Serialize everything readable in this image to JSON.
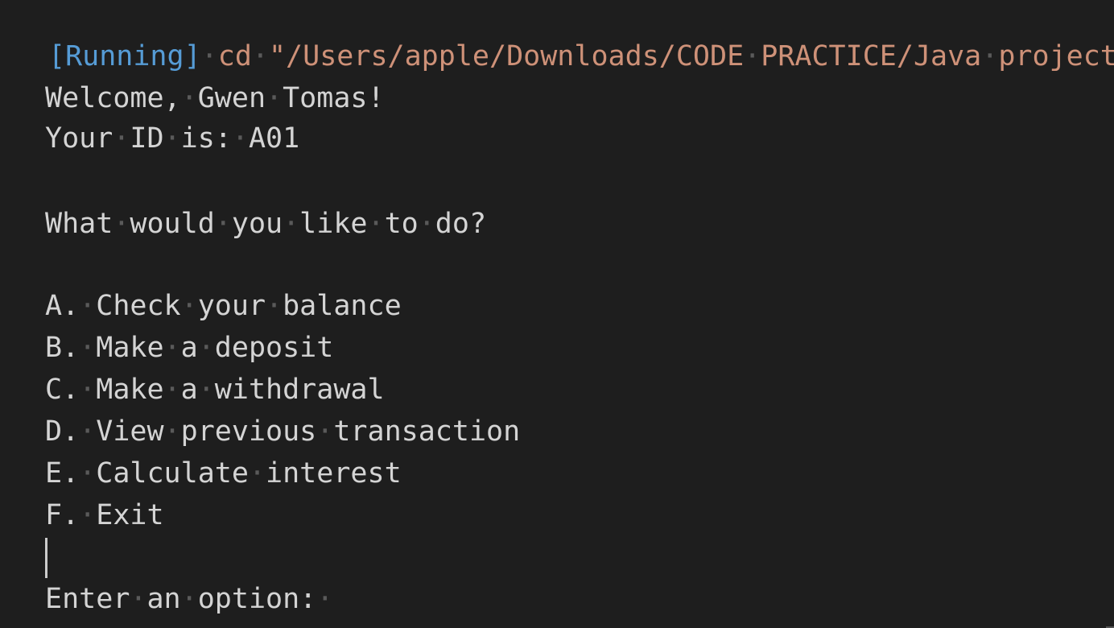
{
  "terminal": {
    "run_tag": "[Running]",
    "command": "cd \"/Users/apple/Downloads/CODE PRACTICE/Java project/",
    "welcome": "Welcome, Gwen Tomas!",
    "id_line": "Your ID is: A01",
    "question": "What would you like to do?",
    "options": [
      "A. Check your balance",
      "B. Make a deposit",
      "C. Make a withdrawal",
      "D. View previous transaction",
      "E. Calculate interest",
      "F. Exit"
    ],
    "prompt": "Enter an option: "
  },
  "colors": {
    "background": "#1e1e1e",
    "text": "#d4d4d4",
    "running": "#569cd6",
    "command": "#ce9178",
    "whitespace_marker": "#5a5a5a"
  }
}
